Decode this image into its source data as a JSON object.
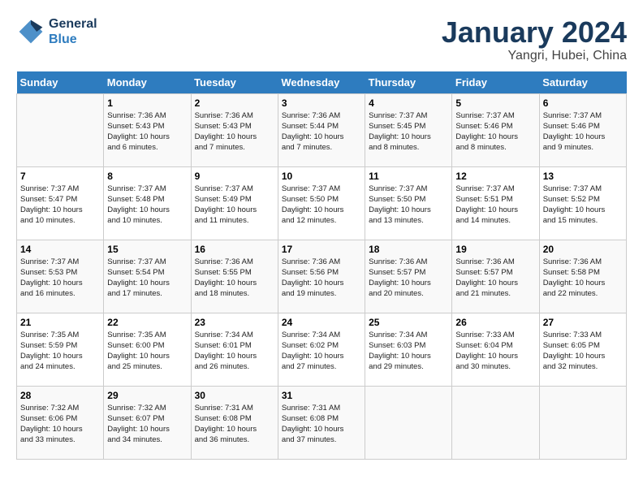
{
  "header": {
    "logo_line1": "General",
    "logo_line2": "Blue",
    "month": "January 2024",
    "location": "Yangri, Hubei, China"
  },
  "weekdays": [
    "Sunday",
    "Monday",
    "Tuesday",
    "Wednesday",
    "Thursday",
    "Friday",
    "Saturday"
  ],
  "weeks": [
    [
      {
        "day": "",
        "info": ""
      },
      {
        "day": "1",
        "info": "Sunrise: 7:36 AM\nSunset: 5:43 PM\nDaylight: 10 hours\nand 6 minutes."
      },
      {
        "day": "2",
        "info": "Sunrise: 7:36 AM\nSunset: 5:43 PM\nDaylight: 10 hours\nand 7 minutes."
      },
      {
        "day": "3",
        "info": "Sunrise: 7:36 AM\nSunset: 5:44 PM\nDaylight: 10 hours\nand 7 minutes."
      },
      {
        "day": "4",
        "info": "Sunrise: 7:37 AM\nSunset: 5:45 PM\nDaylight: 10 hours\nand 8 minutes."
      },
      {
        "day": "5",
        "info": "Sunrise: 7:37 AM\nSunset: 5:46 PM\nDaylight: 10 hours\nand 8 minutes."
      },
      {
        "day": "6",
        "info": "Sunrise: 7:37 AM\nSunset: 5:46 PM\nDaylight: 10 hours\nand 9 minutes."
      }
    ],
    [
      {
        "day": "7",
        "info": "Sunrise: 7:37 AM\nSunset: 5:47 PM\nDaylight: 10 hours\nand 10 minutes."
      },
      {
        "day": "8",
        "info": "Sunrise: 7:37 AM\nSunset: 5:48 PM\nDaylight: 10 hours\nand 10 minutes."
      },
      {
        "day": "9",
        "info": "Sunrise: 7:37 AM\nSunset: 5:49 PM\nDaylight: 10 hours\nand 11 minutes."
      },
      {
        "day": "10",
        "info": "Sunrise: 7:37 AM\nSunset: 5:50 PM\nDaylight: 10 hours\nand 12 minutes."
      },
      {
        "day": "11",
        "info": "Sunrise: 7:37 AM\nSunset: 5:50 PM\nDaylight: 10 hours\nand 13 minutes."
      },
      {
        "day": "12",
        "info": "Sunrise: 7:37 AM\nSunset: 5:51 PM\nDaylight: 10 hours\nand 14 minutes."
      },
      {
        "day": "13",
        "info": "Sunrise: 7:37 AM\nSunset: 5:52 PM\nDaylight: 10 hours\nand 15 minutes."
      }
    ],
    [
      {
        "day": "14",
        "info": "Sunrise: 7:37 AM\nSunset: 5:53 PM\nDaylight: 10 hours\nand 16 minutes."
      },
      {
        "day": "15",
        "info": "Sunrise: 7:37 AM\nSunset: 5:54 PM\nDaylight: 10 hours\nand 17 minutes."
      },
      {
        "day": "16",
        "info": "Sunrise: 7:36 AM\nSunset: 5:55 PM\nDaylight: 10 hours\nand 18 minutes."
      },
      {
        "day": "17",
        "info": "Sunrise: 7:36 AM\nSunset: 5:56 PM\nDaylight: 10 hours\nand 19 minutes."
      },
      {
        "day": "18",
        "info": "Sunrise: 7:36 AM\nSunset: 5:57 PM\nDaylight: 10 hours\nand 20 minutes."
      },
      {
        "day": "19",
        "info": "Sunrise: 7:36 AM\nSunset: 5:57 PM\nDaylight: 10 hours\nand 21 minutes."
      },
      {
        "day": "20",
        "info": "Sunrise: 7:36 AM\nSunset: 5:58 PM\nDaylight: 10 hours\nand 22 minutes."
      }
    ],
    [
      {
        "day": "21",
        "info": "Sunrise: 7:35 AM\nSunset: 5:59 PM\nDaylight: 10 hours\nand 24 minutes."
      },
      {
        "day": "22",
        "info": "Sunrise: 7:35 AM\nSunset: 6:00 PM\nDaylight: 10 hours\nand 25 minutes."
      },
      {
        "day": "23",
        "info": "Sunrise: 7:34 AM\nSunset: 6:01 PM\nDaylight: 10 hours\nand 26 minutes."
      },
      {
        "day": "24",
        "info": "Sunrise: 7:34 AM\nSunset: 6:02 PM\nDaylight: 10 hours\nand 27 minutes."
      },
      {
        "day": "25",
        "info": "Sunrise: 7:34 AM\nSunset: 6:03 PM\nDaylight: 10 hours\nand 29 minutes."
      },
      {
        "day": "26",
        "info": "Sunrise: 7:33 AM\nSunset: 6:04 PM\nDaylight: 10 hours\nand 30 minutes."
      },
      {
        "day": "27",
        "info": "Sunrise: 7:33 AM\nSunset: 6:05 PM\nDaylight: 10 hours\nand 32 minutes."
      }
    ],
    [
      {
        "day": "28",
        "info": "Sunrise: 7:32 AM\nSunset: 6:06 PM\nDaylight: 10 hours\nand 33 minutes."
      },
      {
        "day": "29",
        "info": "Sunrise: 7:32 AM\nSunset: 6:07 PM\nDaylight: 10 hours\nand 34 minutes."
      },
      {
        "day": "30",
        "info": "Sunrise: 7:31 AM\nSunset: 6:08 PM\nDaylight: 10 hours\nand 36 minutes."
      },
      {
        "day": "31",
        "info": "Sunrise: 7:31 AM\nSunset: 6:08 PM\nDaylight: 10 hours\nand 37 minutes."
      },
      {
        "day": "",
        "info": ""
      },
      {
        "day": "",
        "info": ""
      },
      {
        "day": "",
        "info": ""
      }
    ]
  ]
}
